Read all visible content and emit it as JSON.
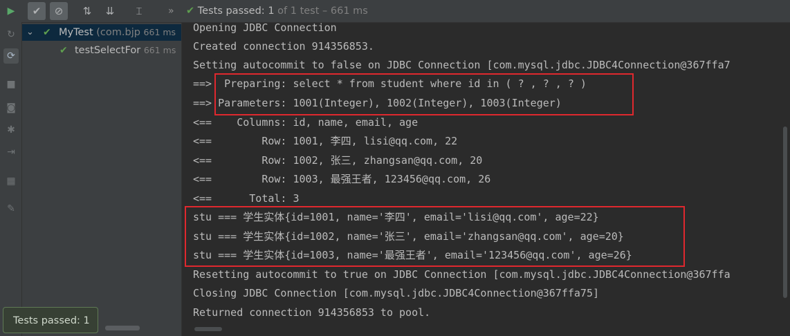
{
  "toolbar": {
    "run_icon": "play-icon",
    "show_passed_icon": "check-icon",
    "show_ignored_icon": "stop-circle-icon",
    "sort_alpha_icon": "sort-alpha-icon",
    "sort_duration_icon": "sort-duration-icon",
    "expand_icon": "expand-all-icon",
    "more_glyph": "»",
    "status_prefix": "Tests passed: ",
    "status_count": "1",
    "status_suffix": " of 1 test – 661 ms"
  },
  "left_strip": {
    "icons": [
      "play-icon",
      "rerun-icon",
      "toggle-auto-test-icon",
      "stop-icon",
      "camera-icon",
      "settings-icon",
      "exit-icon",
      "layout-icon",
      "pin-icon"
    ]
  },
  "tree": {
    "items": [
      {
        "name": "MyTest",
        "pkg": " (com.bjp",
        "time": "661 ms"
      },
      {
        "name": "testSelectFor",
        "time": "661 ms"
      }
    ]
  },
  "console": {
    "lines": [
      "Opening JDBC Connection",
      "Created connection 914356853.",
      "Setting autocommit to false on JDBC Connection [com.mysql.jdbc.JDBC4Connection@367ffa7",
      "==>  Preparing: select * from student where id in ( ? , ? , ? )",
      "==> Parameters: 1001(Integer), 1002(Integer), 1003(Integer)",
      "<==    Columns: id, name, email, age",
      "<==        Row: 1001, 李四, lisi@qq.com, 22",
      "<==        Row: 1002, 张三, zhangsan@qq.com, 20",
      "<==        Row: 1003, 最强王者, 123456@qq.com, 26",
      "<==      Total: 3",
      "stu === 学生实体{id=1001, name='李四', email='lisi@qq.com', age=22}",
      "stu === 学生实体{id=1002, name='张三', email='zhangsan@qq.com', age=20}",
      "stu === 学生实体{id=1003, name='最强王者', email='123456@qq.com', age=26}",
      "Resetting autocommit to true on JDBC Connection [com.mysql.jdbc.JDBC4Connection@367ffa",
      "Closing JDBC Connection [com.mysql.jdbc.JDBC4Connection@367ffa75]",
      "Returned connection 914356853 to pool."
    ]
  },
  "toast": {
    "text": "Tests passed: 1"
  },
  "colors": {
    "highlight": "#e0282e",
    "pass": "#5f9f4f",
    "background": "#2b2b2b",
    "panel": "#3c3f41"
  }
}
